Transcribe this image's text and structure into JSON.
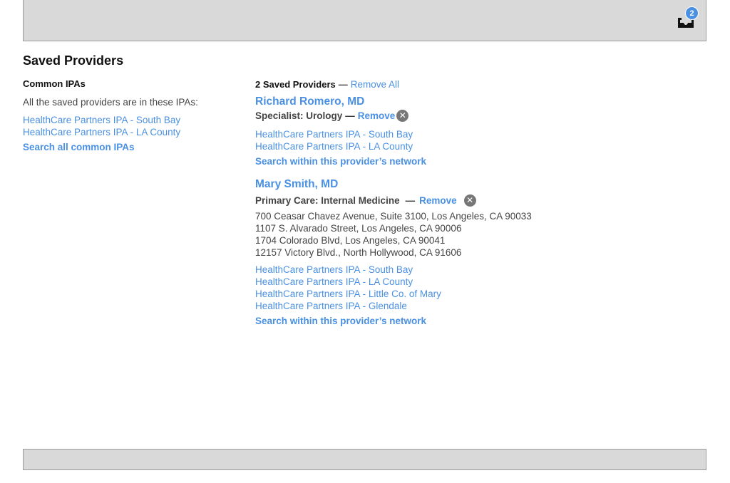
{
  "header": {
    "inbox_badge_count": "2"
  },
  "page": {
    "title": "Saved Providers"
  },
  "common_ipas": {
    "heading": "Common IPAs",
    "note": "All the saved providers are in these IPAs:",
    "ipas": [
      "HealthCare Partners IPA - South Bay",
      "HealthCare Partners IPA - LA County"
    ],
    "search_all_label": "Search all common IPAs"
  },
  "saved": {
    "count_label": "2 Saved Providers",
    "dash": "—",
    "remove_all_label": "Remove All",
    "providers": [
      {
        "name": "Richard Romero, MD",
        "specialty": "Specialist: Urology",
        "remove_label": "Remove",
        "addresses": [],
        "ipas": [
          "HealthCare Partners IPA - South Bay",
          "HealthCare Partners IPA - LA County"
        ],
        "search_label": "Search within this provider’s network"
      },
      {
        "name": "Mary Smith, MD",
        "specialty": "Primary Care: Internal Medicine",
        "remove_label": "Remove",
        "addresses": [
          "700 Ceasar Chavez Avenue, Suite 3100, Los Angeles, CA 90033",
          "1107 S. Alvarado Street, Los Angeles, CA 90006",
          "1704 Colorado Blvd, Los Angeles, CA 90041",
          "12157 Victory Blvd., North Hollywood, CA 91606"
        ],
        "ipas": [
          "HealthCare Partners IPA - South Bay",
          "HealthCare Partners IPA - LA County",
          "HealthCare Partners IPA - Little Co. of Mary",
          "HealthCare Partners IPA - Glendale"
        ],
        "search_label": "Search within this provider’s network"
      }
    ]
  },
  "colors": {
    "link": "#4a90e2",
    "header_bg": "#d9d9d9",
    "remove_icon": "#777777"
  },
  "icons": {
    "inbox": "inbox-tray-icon",
    "remove": "close-circle-icon"
  }
}
